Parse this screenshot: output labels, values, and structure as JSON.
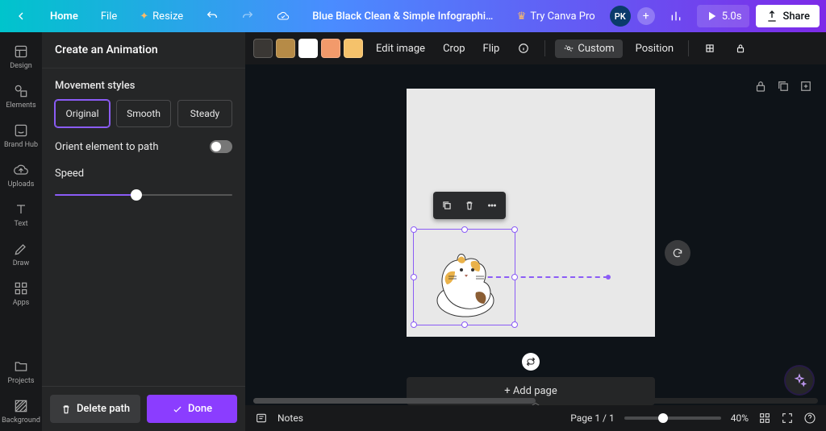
{
  "top": {
    "home": "Home",
    "file": "File",
    "resize": "Resize",
    "title": "Blue Black Clean & Simple Infographic Inspirational Square ...",
    "try_pro": "Try Canva Pro",
    "avatar": "PK",
    "duration": "5.0s",
    "share": "Share"
  },
  "nav": {
    "design": "Design",
    "elements": "Elements",
    "brand": "Brand Hub",
    "uploads": "Uploads",
    "text": "Text",
    "draw": "Draw",
    "apps": "Apps",
    "projects": "Projects",
    "background": "Background"
  },
  "panel": {
    "title": "Create an Animation",
    "section": "Movement styles",
    "styles": [
      "Original",
      "Smooth",
      "Steady"
    ],
    "active_style": 0,
    "orient": "Orient element to path",
    "speed": "Speed",
    "delete": "Delete path",
    "done": "Done"
  },
  "ctx": {
    "swatches": [
      "#3a3734",
      "#b68b47",
      "#ffffff",
      "#f29a6b",
      "#f5c26b"
    ],
    "edit_image": "Edit image",
    "crop": "Crop",
    "flip": "Flip",
    "custom": "Custom",
    "position": "Position"
  },
  "canvas": {
    "add_page": "+ Add page"
  },
  "bottom": {
    "notes": "Notes",
    "page": "Page 1 / 1",
    "zoom": "40%"
  }
}
